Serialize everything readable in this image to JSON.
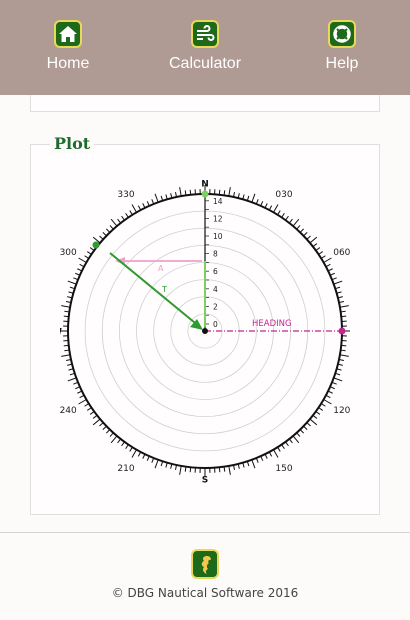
{
  "nav": {
    "home_label": "Home",
    "calculator_label": "Calculator",
    "help_label": "Help"
  },
  "plot": {
    "title": "Plot",
    "compass_labels": {
      "n": "N",
      "e": "E",
      "s": "S",
      "w": "W"
    },
    "bearing_labels": [
      "030",
      "060",
      "120",
      "150",
      "210",
      "240",
      "300",
      "330"
    ],
    "range_labels": [
      "0",
      "2",
      "4",
      "6",
      "8",
      "10",
      "12",
      "14"
    ],
    "vector_labels": {
      "heading": "HEADING",
      "apparent": "A",
      "true": "T"
    },
    "colors": {
      "heading": "#c2268f",
      "apparent": "#f0a0cc",
      "true": "#2f9a2f",
      "boat": "#7fcf5f"
    }
  },
  "footer": {
    "copyright": "© DBG Nautical Software 2016"
  }
}
